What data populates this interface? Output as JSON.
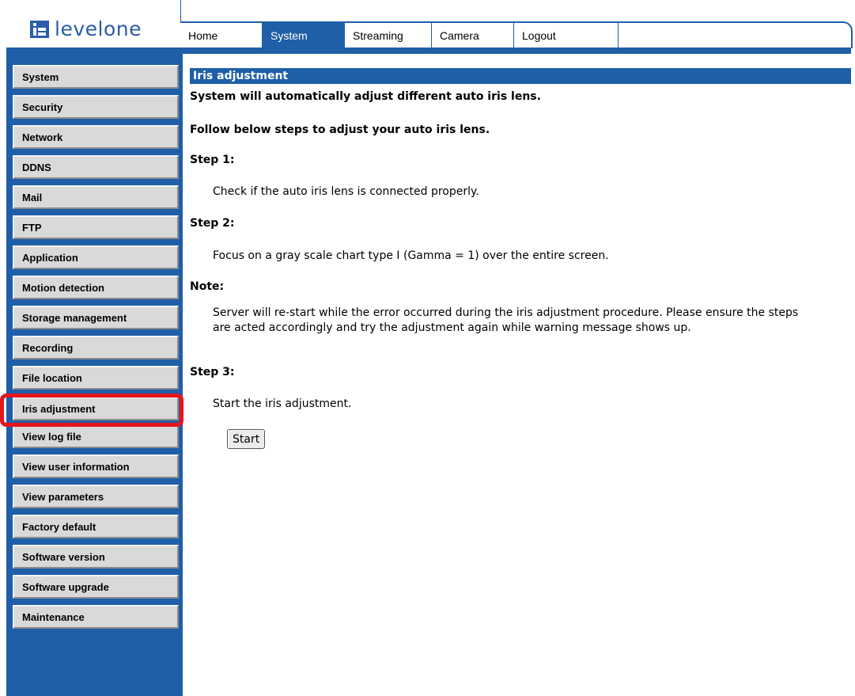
{
  "logo": {
    "text": "levelone"
  },
  "nav": {
    "tabs": [
      {
        "label": "Home",
        "active": false
      },
      {
        "label": "System",
        "active": true
      },
      {
        "label": "Streaming",
        "active": false
      },
      {
        "label": "Camera",
        "active": false
      },
      {
        "label": "Logout",
        "active": false
      }
    ]
  },
  "sidebar": {
    "items": [
      {
        "label": "System"
      },
      {
        "label": "Security"
      },
      {
        "label": "Network"
      },
      {
        "label": "DDNS"
      },
      {
        "label": "Mail"
      },
      {
        "label": "FTP"
      },
      {
        "label": "Application"
      },
      {
        "label": "Motion detection"
      },
      {
        "label": "Storage management"
      },
      {
        "label": "Recording"
      },
      {
        "label": "File location"
      },
      {
        "label": "Iris adjustment",
        "selected": true
      },
      {
        "label": "View log file"
      },
      {
        "label": "View user information"
      },
      {
        "label": "View parameters"
      },
      {
        "label": "Factory default"
      },
      {
        "label": "Software version"
      },
      {
        "label": "Software upgrade"
      },
      {
        "label": "Maintenance"
      }
    ]
  },
  "main": {
    "title": "Iris adjustment",
    "intro": "System will automatically adjust different auto iris lens.",
    "follow": "Follow below steps to adjust your auto iris lens.",
    "step1_label": "Step 1:",
    "step1_text": "Check if the auto iris lens is connected properly.",
    "step2_label": "Step 2:",
    "step2_text": "Focus on a gray scale chart type I (Gamma = 1) over the entire screen.",
    "note_label": "Note:",
    "note_text": "Server will re-start while the error occurred during the iris adjustment procedure. Please ensure the steps are acted accordingly and try the adjustment again while warning message shows up.",
    "step3_label": "Step 3:",
    "step3_text": "Start the iris adjustment.",
    "start_button": "Start"
  },
  "colors": {
    "brand_blue": "#1f5fa8",
    "highlight_red": "#e8141c"
  }
}
